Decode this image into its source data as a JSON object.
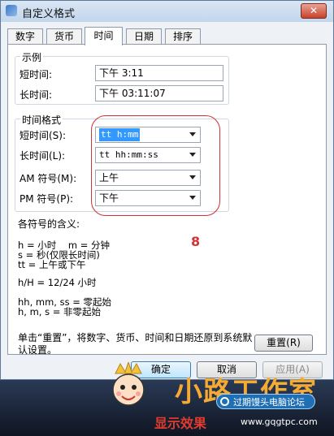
{
  "window": {
    "title": "自定义格式",
    "close": "✕"
  },
  "tabs": [
    "数字",
    "货币",
    "时间",
    "日期",
    "排序"
  ],
  "example": {
    "title": "示例",
    "short_label": "短时间:",
    "short_value": "下午 3:11",
    "long_label": "长时间:",
    "long_value": "下午 03:11:07"
  },
  "format": {
    "title": "时间格式",
    "short_label": "短时间(S):",
    "short_value": "tt h:mm",
    "long_label": "长时间(L):",
    "long_value": "tt hh:mm:ss",
    "am_label": "AM 符号(M):",
    "am_value": "上午",
    "pm_label": "PM 符号(P):",
    "pm_value": "下午"
  },
  "annotation": "8",
  "meaning": {
    "title": "各符号的含义:",
    "line1": "h = 小时    m = 分钟",
    "line2": "s = 秒(仅限长时间)",
    "line3": "tt = 上午或下午",
    "line4": "h/H = 12/24 小时",
    "line5": "hh, mm, ss = 零起始",
    "line6": "h, m, s = 非零起始"
  },
  "note": "单击“重置”，将数字、货币、时间和日期还原到系统默认设置。",
  "buttons": {
    "reset": "重置(R)",
    "ok": "确定",
    "cancel": "取消",
    "apply": "应用(A)"
  },
  "watermark": {
    "brand": "小路工作室",
    "tagline": "显示效果",
    "badge": "过期馒头电脑论坛",
    "url": "www.gqgtpc.com"
  }
}
